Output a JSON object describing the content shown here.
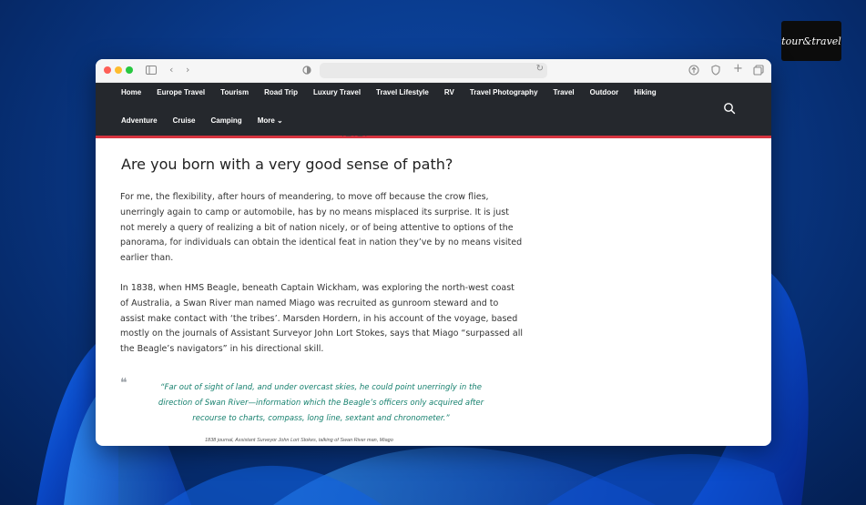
{
  "logo": {
    "text": "tour&travel",
    "subtext": ""
  },
  "browser": {
    "url": ""
  },
  "nav": {
    "row1": [
      "Home",
      "Europe Travel",
      "Tourism",
      "Road Trip",
      "Luxury Travel",
      "Travel Lifestyle",
      "RV",
      "Travel Photography",
      "Travel",
      "Outdoor",
      "Hiking"
    ],
    "row2": [
      "Adventure",
      "Cruise",
      "Camping",
      "More ⌄"
    ]
  },
  "article": {
    "cut_line": "· ─ · ─ ·",
    "heading": "Are you born with a very good sense of path?",
    "paragraph1": "For me, the flexibility, after hours of meandering, to move off because the crow flies, unerringly again to camp or automobile, has by no means misplaced its surprise. It is just not merely a query of realizing a bit of nation nicely, or of being attentive to options of the panorama, for individuals can obtain the identical feat in nation they’ve by no means visited earlier than.",
    "paragraph2": "In 1838, when HMS Beagle, beneath Captain Wickham, was exploring the north-west coast of Australia, a Swan River man named Miago was recruited as gunroom steward and to assist make contact with ‘the tribes’. Marsden Hordern, in his account of the voyage, based mostly on the journals of Assistant Surveyor John Lort Stokes, says that Miago “surpassed all the Beagle’s navigators” in his directional skill.",
    "quote": "“Far out of sight of land, and under overcast skies, he could point unerringly in the direction of Swan River—information which the Beagle’s officers only acquired after recourse to charts, compass, long line, sextant and chronometer.”",
    "caption": "1838 journal, Assistant Surveyor John Lort Stokes, talking of Swan River man, Miago"
  },
  "colors": {
    "nav_bg": "#25282d",
    "accent_red": "#d6333f",
    "quote_green": "#16806e"
  }
}
